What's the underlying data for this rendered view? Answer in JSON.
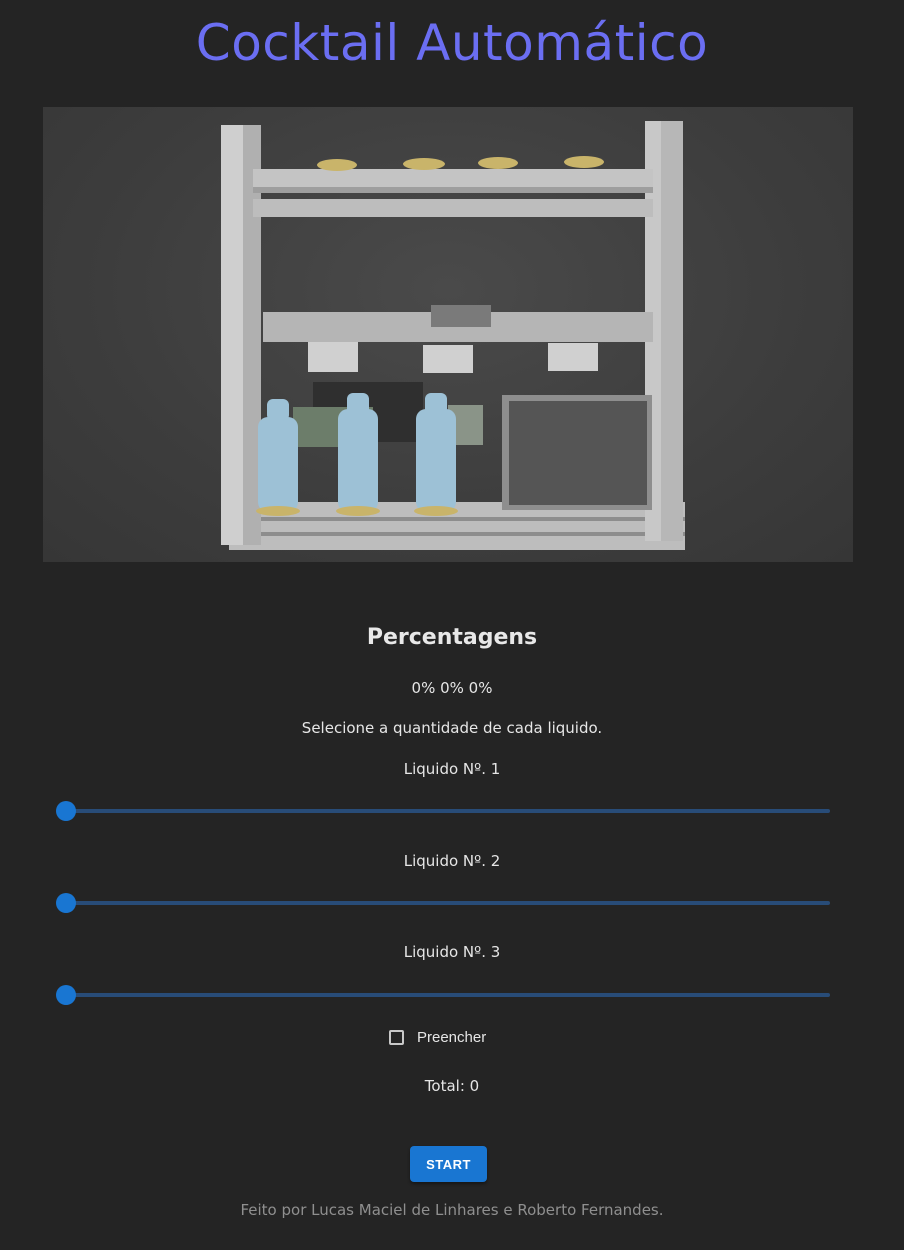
{
  "header": {
    "title": "Cocktail Automático"
  },
  "scene": {
    "image_icon": "cocktail-machine-3d-render"
  },
  "percentages": {
    "heading": "Percentagens",
    "summary": "0% 0% 0%",
    "instructions": "Selecione a quantidade de cada liquido."
  },
  "liquids": [
    {
      "label": "Liquido Nº. 1",
      "value": 0
    },
    {
      "label": "Liquido Nº. 2",
      "value": 0
    },
    {
      "label": "Liquido Nº. 3",
      "value": 0
    }
  ],
  "fill_option": {
    "label": "Preencher",
    "checked": false
  },
  "total": {
    "text": "Total: 0"
  },
  "actions": {
    "start_label": "START"
  },
  "footer": {
    "credits": "Feito por Lucas Maciel de Linhares e Roberto Fernandes."
  },
  "colors": {
    "accent": "#1976d2",
    "title": "#6b6ef2",
    "background": "#242424"
  }
}
